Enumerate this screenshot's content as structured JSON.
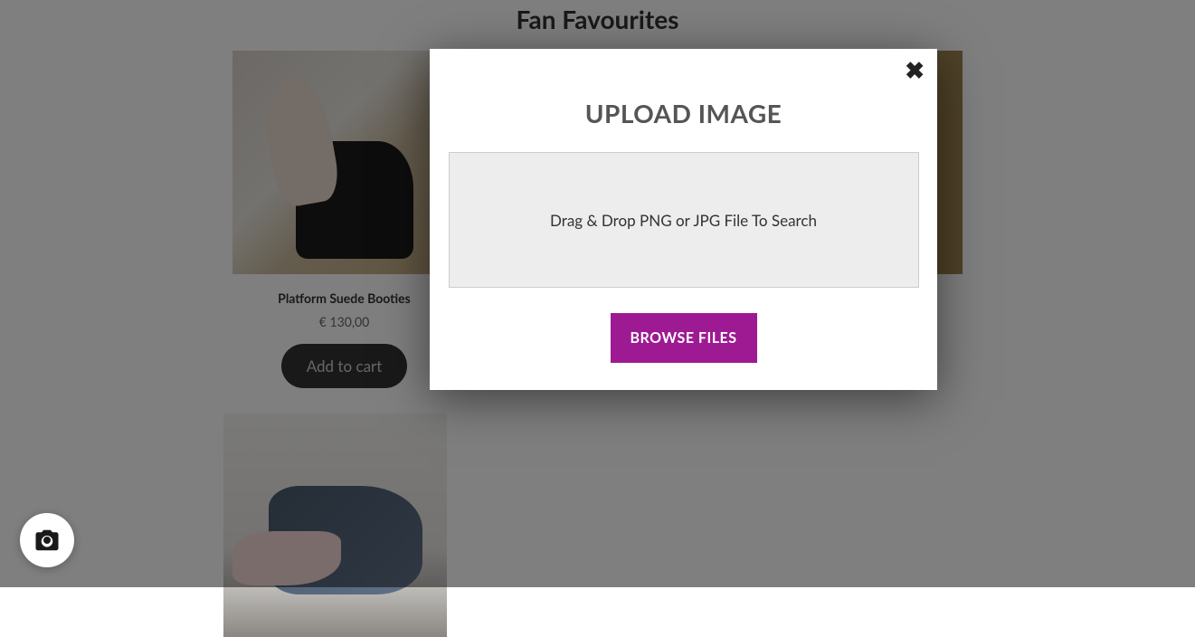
{
  "section": {
    "title": "Fan Favourites"
  },
  "products": [
    {
      "name": "Platform Suede Booties",
      "price": "€ 130,00",
      "cta": "Add to cart"
    },
    {
      "name": "",
      "price": "",
      "cta": ""
    },
    {
      "name": "",
      "price": "",
      "cta": ""
    },
    {
      "name": "",
      "price": "",
      "cta": ""
    }
  ],
  "modal": {
    "title": "UPLOAD IMAGE",
    "dropzone_text": "Drag & Drop PNG or JPG File To Search",
    "browse_label": "BROWSE FILES",
    "close_glyph": "✖"
  },
  "fab": {
    "name": "camera-icon"
  },
  "colors": {
    "accent": "#9e1a93",
    "button_dark": "#333333"
  }
}
